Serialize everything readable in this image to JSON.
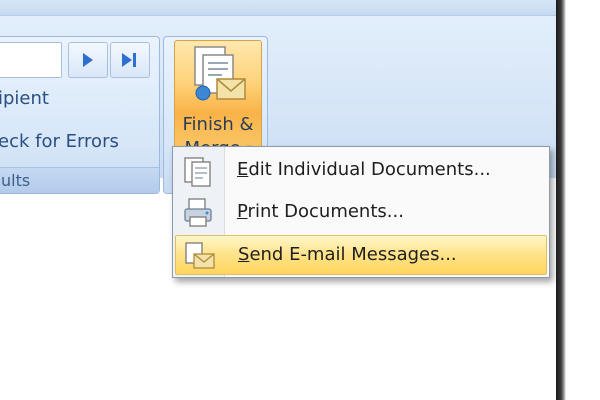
{
  "ribbon": {
    "group_left": {
      "caption": "ults",
      "items": [
        "ipient",
        "eck for Errors"
      ],
      "icons": {
        "next": "play-next-icon",
        "last": "skip-last-icon"
      }
    },
    "finish_merge": {
      "label_line1": "Finish &",
      "label_line2": "Merge",
      "icon": "finish-merge-icon"
    }
  },
  "menu": {
    "items": [
      {
        "key": "E",
        "rest": "dit Individual Documents...",
        "icon": "edit-documents-icon",
        "highlighted": false
      },
      {
        "key": "P",
        "rest": "rint Documents...",
        "icon": "print-documents-icon",
        "highlighted": false
      },
      {
        "key": "S",
        "rest": "end E-mail Messages...",
        "icon": "send-email-icon",
        "highlighted": true
      }
    ]
  },
  "colors": {
    "ribbon_blue": "#d5e5f7",
    "accent_orange": "#f9b348",
    "menu_highlight": "#ffe388"
  }
}
